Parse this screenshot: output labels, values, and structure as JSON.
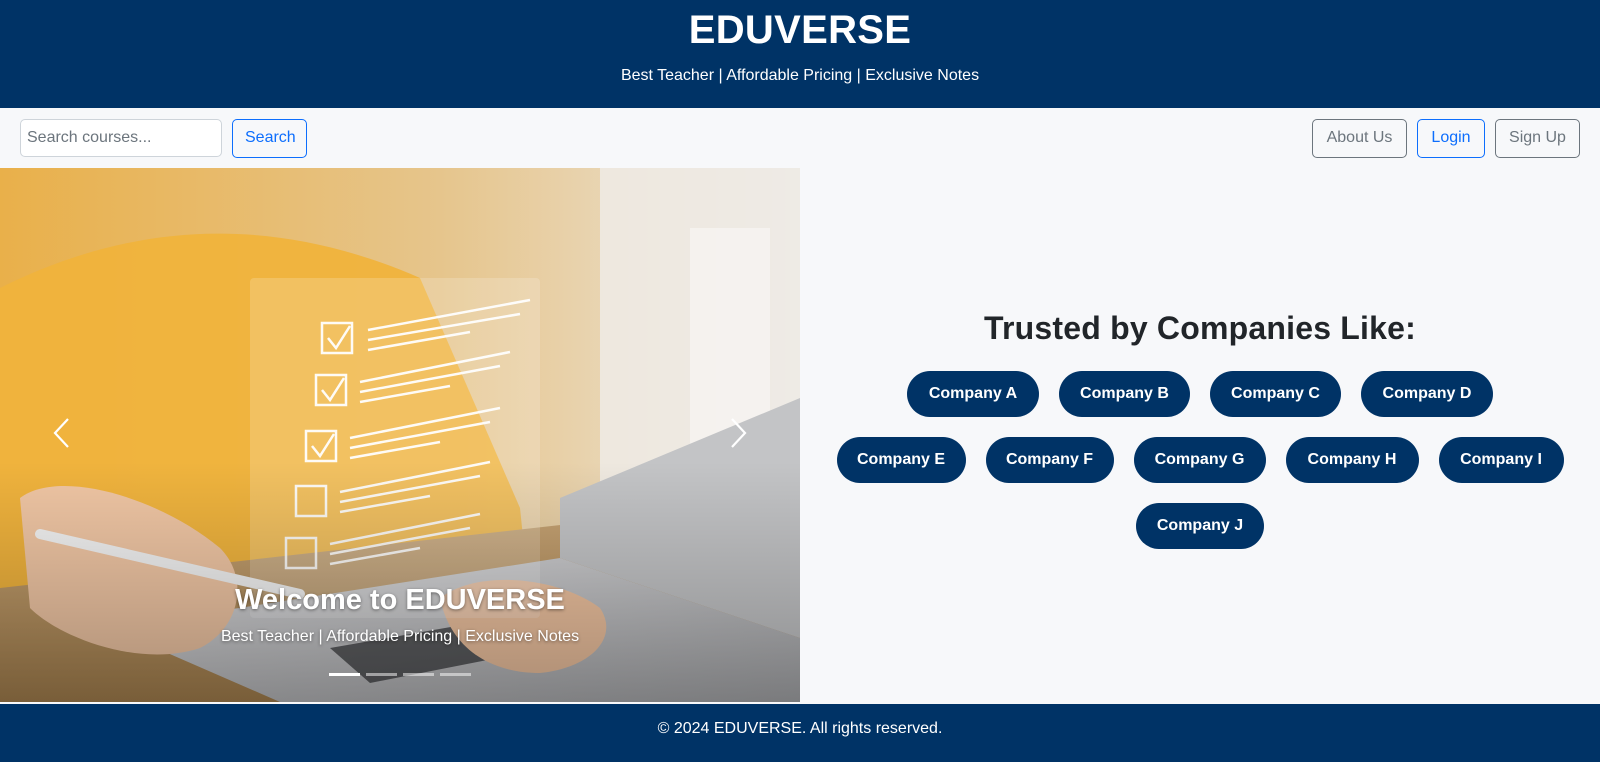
{
  "header": {
    "title": "EDUVERSE",
    "tagline": "Best Teacher | Affordable Pricing | Exclusive Notes"
  },
  "nav": {
    "search_placeholder": "Search courses...",
    "search_label": "Search",
    "about_label": "About Us",
    "login_label": "Login",
    "signup_label": "Sign Up"
  },
  "carousel": {
    "caption_title": "Welcome to EDUVERSE",
    "caption_subtitle": "Best Teacher | Affordable Pricing | Exclusive Notes",
    "active_slide": 1,
    "slide_count": 4
  },
  "trusted": {
    "title": "Trusted by Companies Like:",
    "companies": [
      "Company A",
      "Company B",
      "Company C",
      "Company D",
      "Company E",
      "Company F",
      "Company G",
      "Company H",
      "Company I",
      "Company J"
    ]
  },
  "footer": {
    "text": "© 2024 EDUVERSE. All rights reserved."
  },
  "colors": {
    "brand_navy": "#003366",
    "primary_blue": "#0d6efd",
    "secondary_gray": "#6c757d",
    "page_bg": "#f7f8fa"
  }
}
